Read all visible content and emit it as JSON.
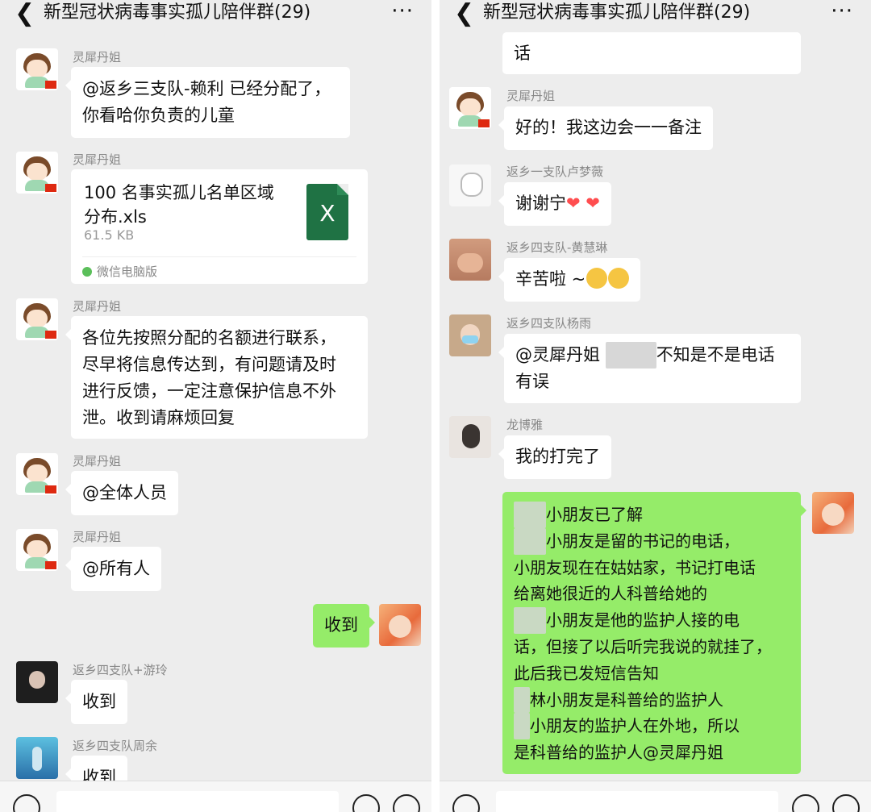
{
  "left": {
    "title": "新型冠状病毒事实孤儿陪伴群(29)",
    "back_icon": "chevron-left-icon",
    "more_icon": "more-dots-icon",
    "more": "···",
    "messages": [
      {
        "sender": "灵犀丹姐",
        "lines": [
          "@返乡三支队-赖利  已经分配了，",
          "你看哈你负责的儿童"
        ]
      },
      {
        "sender": "灵犀丹姐",
        "file": {
          "name_lines": [
            "100 名事实孤儿名单区域",
            "分布.xls"
          ],
          "size": "61.5 KB",
          "source": "微信电脑版",
          "icon_letter": "X"
        }
      },
      {
        "sender": "灵犀丹姐",
        "lines": [
          "各位先按照分配的名额进行联系，",
          "尽早将信息传达到，有问题请及时",
          "进行反馈，一定注意保护信息不外",
          "泄。收到请麻烦回复"
        ]
      },
      {
        "sender": "灵犀丹姐",
        "lines": [
          "@全体人员"
        ]
      },
      {
        "sender": "灵犀丹姐",
        "lines": [
          "@所有人"
        ]
      },
      {
        "self": true,
        "lines": [
          "收到"
        ]
      },
      {
        "sender": "返乡四支队+游玲",
        "lines": [
          "收到"
        ]
      },
      {
        "sender": "返乡四支队周余",
        "lines": [
          "收到"
        ]
      }
    ]
  },
  "right": {
    "title": "新型冠状病毒事实孤儿陪伴群(29)",
    "more": "···",
    "messages": [
      {
        "partial": true,
        "lines": [
          "话"
        ]
      },
      {
        "sender": "灵犀丹姐",
        "lines": [
          "好的！我这边会一一备注"
        ]
      },
      {
        "sender": "返乡一支队卢梦薇",
        "text": "谢谢宁",
        "emoji": "❤ ❤"
      },
      {
        "sender": "返乡四支队-黄慧琳",
        "text": "辛苦啦 ~"
      },
      {
        "sender": "返乡四支队杨雨",
        "lines": [
          "@灵犀丹姐",
          "不知是不是电话",
          "有误"
        ]
      },
      {
        "sender": "龙博雅",
        "lines": [
          "我的打完了"
        ]
      },
      {
        "self": true,
        "lines": [
          "小朋友已了解",
          "小朋友是留的书记的电话，",
          "小朋友现在在姑姑家，书记打电话",
          "给离她很近的人科普给她的",
          "小朋友是他的监护人接的电",
          "话，但接了以后听完我说的就挂了，",
          "此后我已发短信告知",
          "林小朋友是科普给的监护人",
          "小朋友的监护人在外地，所以",
          "是科普给的监护人@灵犀丹姐"
        ]
      }
    ]
  },
  "colors": {
    "self_bubble": "#95ec69",
    "other_bubble": "#ffffff",
    "chat_bg": "#ededed"
  }
}
